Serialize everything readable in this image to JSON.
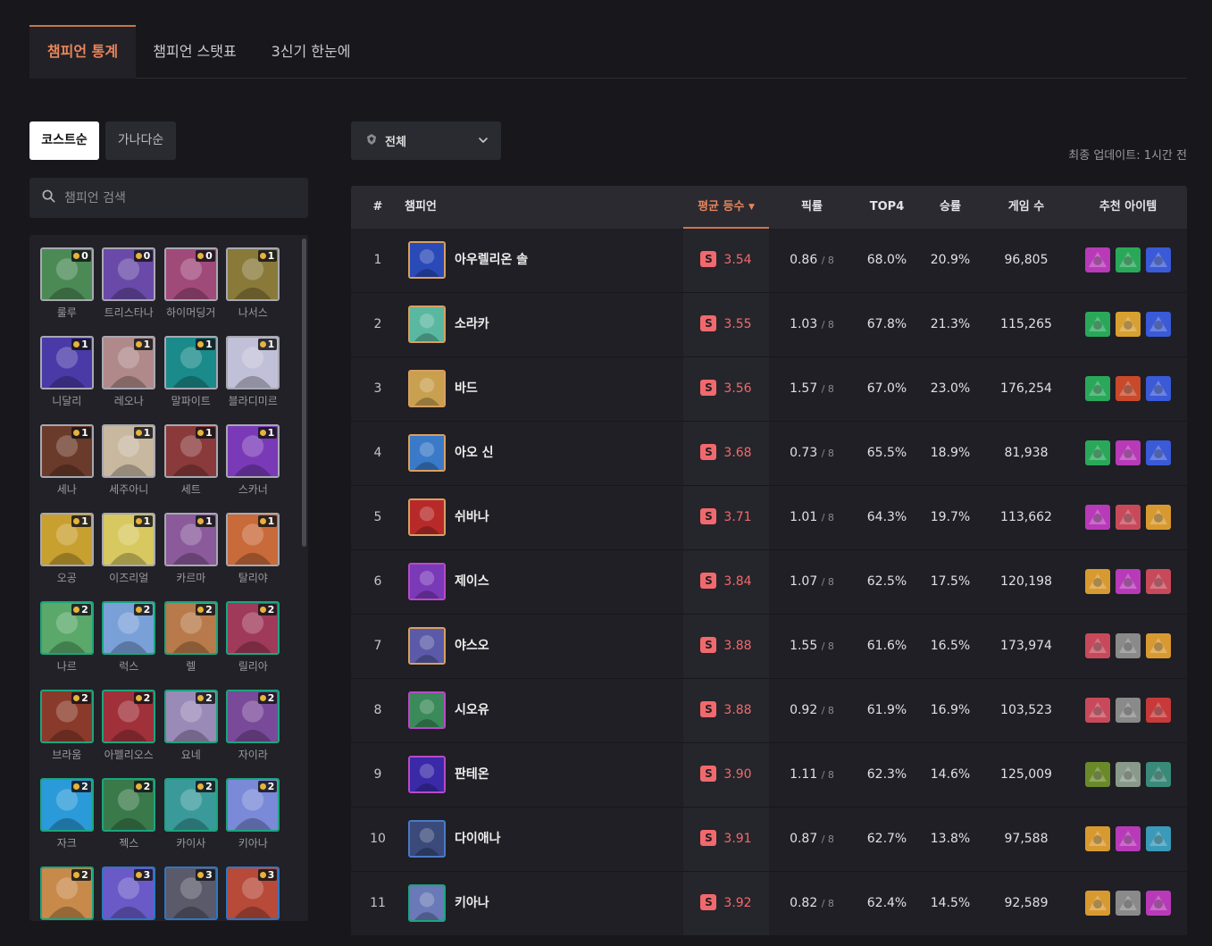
{
  "tabs": [
    {
      "label": "챔피언 통계",
      "active": true
    },
    {
      "label": "챔피언 스탯표",
      "active": false
    },
    {
      "label": "3신기 한눈에",
      "active": false
    }
  ],
  "sort_buttons": [
    {
      "label": "코스트순",
      "active": true
    },
    {
      "label": "가나다순",
      "active": false
    }
  ],
  "search": {
    "placeholder": "챔피언 검색"
  },
  "champions": [
    {
      "name": "룰루",
      "cost": "0",
      "color": "#4c8a55"
    },
    {
      "name": "트리스타나",
      "cost": "0",
      "color": "#6a4aa8"
    },
    {
      "name": "하이머딩거",
      "cost": "0",
      "color": "#a04a7a"
    },
    {
      "name": "나서스",
      "cost": "1",
      "color": "#8a7a3a"
    },
    {
      "name": "니달리",
      "cost": "1",
      "color": "#4a3aa8"
    },
    {
      "name": "레오나",
      "cost": "1",
      "color": "#b08a8a"
    },
    {
      "name": "말파이트",
      "cost": "1",
      "color": "#1a8a8a"
    },
    {
      "name": "블라디미르",
      "cost": "1",
      "color": "#c0c0d8"
    },
    {
      "name": "세나",
      "cost": "1",
      "color": "#6a3a2a"
    },
    {
      "name": "세주아니",
      "cost": "1",
      "color": "#c8b8a0"
    },
    {
      "name": "세트",
      "cost": "1",
      "color": "#8a3a3a"
    },
    {
      "name": "스카너",
      "cost": "1",
      "color": "#7a3ab8"
    },
    {
      "name": "오공",
      "cost": "1",
      "color": "#c8a030"
    },
    {
      "name": "이즈리얼",
      "cost": "1",
      "color": "#d8c860"
    },
    {
      "name": "카르마",
      "cost": "1",
      "color": "#8a5a9a"
    },
    {
      "name": "탈리야",
      "cost": "1",
      "color": "#c86a3a"
    },
    {
      "name": "나르",
      "cost": "2",
      "color": "#5aa86a"
    },
    {
      "name": "럭스",
      "cost": "2",
      "color": "#7aa0d8"
    },
    {
      "name": "렐",
      "cost": "2",
      "color": "#b87a4a"
    },
    {
      "name": "릴리아",
      "cost": "2",
      "color": "#a03a5a"
    },
    {
      "name": "브라움",
      "cost": "2",
      "color": "#8a3a2a"
    },
    {
      "name": "아펠리오스",
      "cost": "2",
      "color": "#a0303a"
    },
    {
      "name": "요네",
      "cost": "2",
      "color": "#9a8ab8"
    },
    {
      "name": "자이라",
      "cost": "2",
      "color": "#7a4a9a"
    },
    {
      "name": "자크",
      "cost": "2",
      "color": "#2a9ad8"
    },
    {
      "name": "젝스",
      "cost": "2",
      "color": "#3a7a4a"
    },
    {
      "name": "카이사",
      "cost": "2",
      "color": "#3a9a9a"
    },
    {
      "name": "키아나",
      "cost": "2",
      "color": "#7a8ad8"
    },
    {
      "name": "",
      "cost": "2",
      "color": "#c88a4a"
    },
    {
      "name": "",
      "cost": "3",
      "color": "#6a5ac8"
    },
    {
      "name": "",
      "cost": "3",
      "color": "#5a5a6a"
    },
    {
      "name": "",
      "cost": "3",
      "color": "#b84a3a"
    }
  ],
  "filter": {
    "label": "전체",
    "icon": "trait-icon"
  },
  "last_updated": "최종 업데이트: 1시간 전",
  "table": {
    "headers": {
      "rank": "#",
      "champion": "챔피언",
      "avg_place": "평균 등수",
      "pick_rate": "픽률",
      "top4": "TOP4",
      "win_rate": "승률",
      "games": "게임 수",
      "items": "추천 아이템"
    },
    "sorted_by": "평균 등수",
    "rows": [
      {
        "rank": "1",
        "name": "아우렐리온 솔",
        "tier": "S",
        "avg": "3.54",
        "pick": "0.86",
        "pick_den": "/ 8",
        "top4": "68.0%",
        "win": "20.9%",
        "games": "96,805",
        "icon_color": "#2a4ab8",
        "border": "#d8a060",
        "items": [
          "#b83ab8",
          "#2aa85a",
          "#3a5ad8"
        ]
      },
      {
        "rank": "2",
        "name": "소라카",
        "tier": "S",
        "avg": "3.55",
        "pick": "1.03",
        "pick_den": "/ 8",
        "top4": "67.8%",
        "win": "21.3%",
        "games": "115,265",
        "icon_color": "#5ab8a0",
        "border": "#d8a060",
        "items": [
          "#2aa85a",
          "#d8a030",
          "#3a5ad8"
        ]
      },
      {
        "rank": "3",
        "name": "바드",
        "tier": "S",
        "avg": "3.56",
        "pick": "1.57",
        "pick_den": "/ 8",
        "top4": "67.0%",
        "win": "23.0%",
        "games": "176,254",
        "icon_color": "#c8a050",
        "border": "#d8a060",
        "items": [
          "#2aa85a",
          "#c84a2a",
          "#3a5ad8"
        ]
      },
      {
        "rank": "4",
        "name": "아오 신",
        "tier": "S",
        "avg": "3.68",
        "pick": "0.73",
        "pick_den": "/ 8",
        "top4": "65.5%",
        "win": "18.9%",
        "games": "81,938",
        "icon_color": "#3a7ac8",
        "border": "#d8a060",
        "items": [
          "#2aa85a",
          "#b83ab8",
          "#3a5ad8"
        ]
      },
      {
        "rank": "5",
        "name": "쉬바나",
        "tier": "S",
        "avg": "3.71",
        "pick": "1.01",
        "pick_den": "/ 8",
        "top4": "64.3%",
        "win": "19.7%",
        "games": "113,662",
        "icon_color": "#b82a2a",
        "border": "#d8a060",
        "items": [
          "#b83ab8",
          "#c84a5a",
          "#d89a30"
        ]
      },
      {
        "rank": "6",
        "name": "제이스",
        "tier": "S",
        "avg": "3.84",
        "pick": "1.07",
        "pick_den": "/ 8",
        "top4": "62.5%",
        "win": "17.5%",
        "games": "120,198",
        "icon_color": "#7a3ab8",
        "border": "#b84ac8",
        "items": [
          "#d89a30",
          "#b83ab8",
          "#c84a5a"
        ]
      },
      {
        "rank": "7",
        "name": "야스오",
        "tier": "S",
        "avg": "3.88",
        "pick": "1.55",
        "pick_den": "/ 8",
        "top4": "61.6%",
        "win": "16.5%",
        "games": "173,974",
        "icon_color": "#5a5aa8",
        "border": "#d8a060",
        "items": [
          "#c84a5a",
          "#8a8a8a",
          "#d89a30"
        ]
      },
      {
        "rank": "8",
        "name": "시오유",
        "tier": "S",
        "avg": "3.88",
        "pick": "0.92",
        "pick_den": "/ 8",
        "top4": "61.9%",
        "win": "16.9%",
        "games": "103,523",
        "icon_color": "#3a8a5a",
        "border": "#b84ac8",
        "items": [
          "#c84a5a",
          "#8a8a8a",
          "#c83a3a"
        ]
      },
      {
        "rank": "9",
        "name": "판테온",
        "tier": "S",
        "avg": "3.90",
        "pick": "1.11",
        "pick_den": "/ 8",
        "top4": "62.3%",
        "win": "14.6%",
        "games": "125,009",
        "icon_color": "#3a2aa8",
        "border": "#b84ac8",
        "items": [
          "#6a8a2a",
          "#8a9a8a",
          "#3a8a7a"
        ]
      },
      {
        "rank": "10",
        "name": "다이애나",
        "tier": "S",
        "avg": "3.91",
        "pick": "0.87",
        "pick_den": "/ 8",
        "top4": "62.7%",
        "win": "13.8%",
        "games": "97,588",
        "icon_color": "#3a4a7a",
        "border": "#4a7ac8",
        "items": [
          "#d89a30",
          "#b83ab8",
          "#3a9ab8"
        ]
      },
      {
        "rank": "11",
        "name": "키아나",
        "tier": "S",
        "avg": "3.92",
        "pick": "0.82",
        "pick_den": "/ 8",
        "top4": "62.4%",
        "win": "14.5%",
        "games": "92,589",
        "icon_color": "#6a7ab8",
        "border": "#1ba57e",
        "items": [
          "#d89a30",
          "#8a8a8a",
          "#b83ab8"
        ]
      }
    ]
  }
}
